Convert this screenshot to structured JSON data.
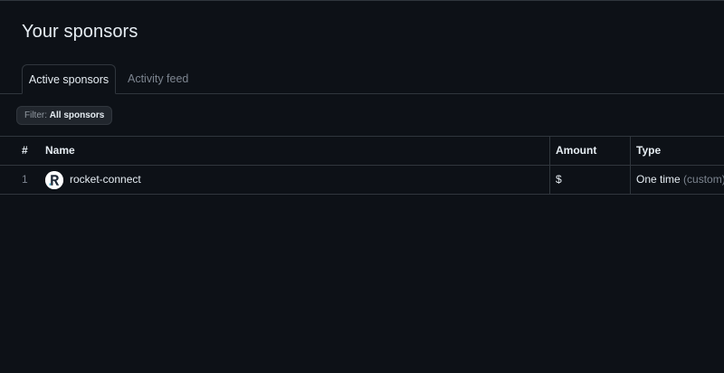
{
  "page": {
    "title": "Your sponsors"
  },
  "tabs": [
    {
      "label": "Active sponsors",
      "active": true
    },
    {
      "label": "Activity feed",
      "active": false
    }
  ],
  "filter": {
    "prefix": "Filter:",
    "value": "All sponsors"
  },
  "table": {
    "columns": [
      "#",
      "Name",
      "Amount",
      "Type"
    ],
    "rows": [
      {
        "index": "1",
        "name": "rocket-connect",
        "avatar_letter": "R",
        "avatar_icon": "rocket-connect-logo-icon",
        "amount": "$",
        "type": "One time",
        "type_qualifier": "(custom)"
      }
    ]
  },
  "colors": {
    "background": "#0d1117",
    "border": "#30363d",
    "text": "#e6edf3",
    "muted": "#7d8590",
    "button_bg": "#21262d"
  }
}
